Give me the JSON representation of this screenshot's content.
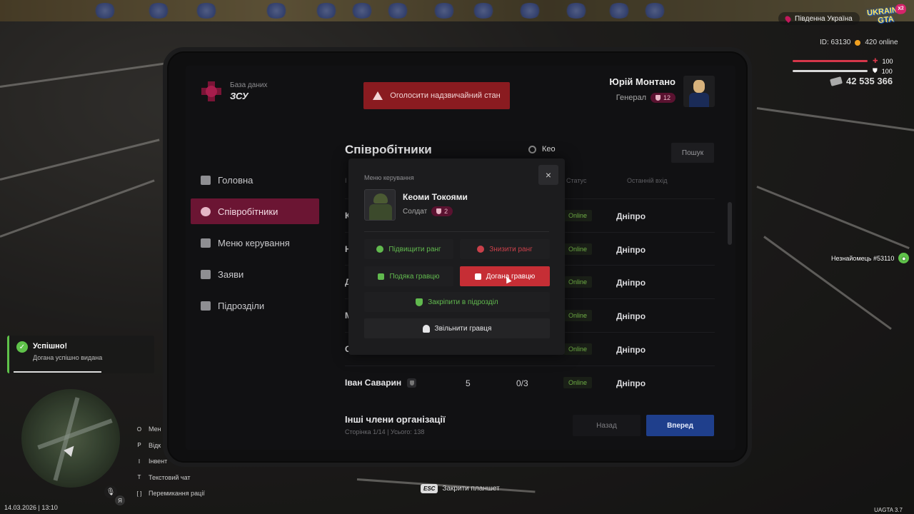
{
  "hud": {
    "region": "Південна Україна",
    "logo_line1": "UKRAINE",
    "logo_line2": "GTA",
    "logo_badge": "X2",
    "player_id": "ID: 63130",
    "online": "420 online",
    "health": "100",
    "armor": "100",
    "money": "42 535 366",
    "stranger_label": "Незнайомець #53110",
    "datetime": "14.03.2026 | 13:10",
    "esc_key": "ESC",
    "esc_hint": "Закрити планшет",
    "version": "UAGTA 3.7",
    "voice_badge": "Я",
    "hotkeys": [
      {
        "key": "O",
        "label": "Мен"
      },
      {
        "key": "P",
        "label": "Відк"
      },
      {
        "key": "I",
        "label": "Інвент"
      },
      {
        "key": "T",
        "label": "Текстовий чат"
      },
      {
        "key": "[  ]",
        "label": "Перемикання рації"
      }
    ],
    "colors": {
      "health": "#d6374a",
      "armor": "#d9d9d9"
    }
  },
  "notification": {
    "title": "Успішно!",
    "message": "Догана успішно видана"
  },
  "tablet": {
    "brand_sub": "База даних",
    "brand_title": "ЗСУ",
    "emergency_button": "Оголосити надзвичайний стан",
    "user": {
      "name": "Юрій Монтано",
      "rank": "Генерал",
      "rank_level": "12"
    },
    "nav": [
      {
        "label": "Головна",
        "icon": "home-icon"
      },
      {
        "label": "Співробітники",
        "icon": "users-icon",
        "active": true
      },
      {
        "label": "Меню керування",
        "icon": "gear-icon"
      },
      {
        "label": "Заяви",
        "icon": "folder-icon"
      },
      {
        "label": "Підрозділи",
        "icon": "shield-icon"
      }
    ],
    "section_title": "Співробітники",
    "search_value": "Кео",
    "search_button": "Пошук",
    "columns": {
      "col0": "І",
      "status": "Статус",
      "last_login": "Останній вхід"
    },
    "rows": [
      {
        "name": "К",
        "c1": "",
        "c2": "",
        "status": "Online",
        "city": "Дніпро"
      },
      {
        "name": "Н",
        "c1": "",
        "c2": "",
        "status": "Online",
        "city": "Дніпро"
      },
      {
        "name": "Д",
        "c1": "",
        "c2": "",
        "status": "Online",
        "city": "Дніпро"
      },
      {
        "name": "М",
        "c1": "",
        "c2": "",
        "status": "Online",
        "city": "Дніпро"
      },
      {
        "name": "С",
        "c1": "",
        "c2": "",
        "status": "Online",
        "city": "Дніпро"
      },
      {
        "name": "Іван Саварин",
        "c1": "5",
        "c2": "0/3",
        "status": "Online",
        "city": "Дніпро"
      }
    ],
    "others_title": "Інші члени організації",
    "others_info": "Сторінка 1/14 | Усього: 138",
    "back_button": "Назад",
    "next_button": "Вперед",
    "accent_color": "#6b1533"
  },
  "modal": {
    "title": "Меню керування",
    "close": "×",
    "player_name": "Кеоми Токоями",
    "player_rank": "Солдат",
    "player_rank_level": "2",
    "btn_rank_up": "Підвищити ранг",
    "btn_rank_down": "Знизити ранг",
    "btn_thanks": "Подяка гравцю",
    "btn_reprimand": "Догана гравцю",
    "btn_assign": "Закріпити в підрозділ",
    "btn_fire": "Звільнити гравця"
  }
}
